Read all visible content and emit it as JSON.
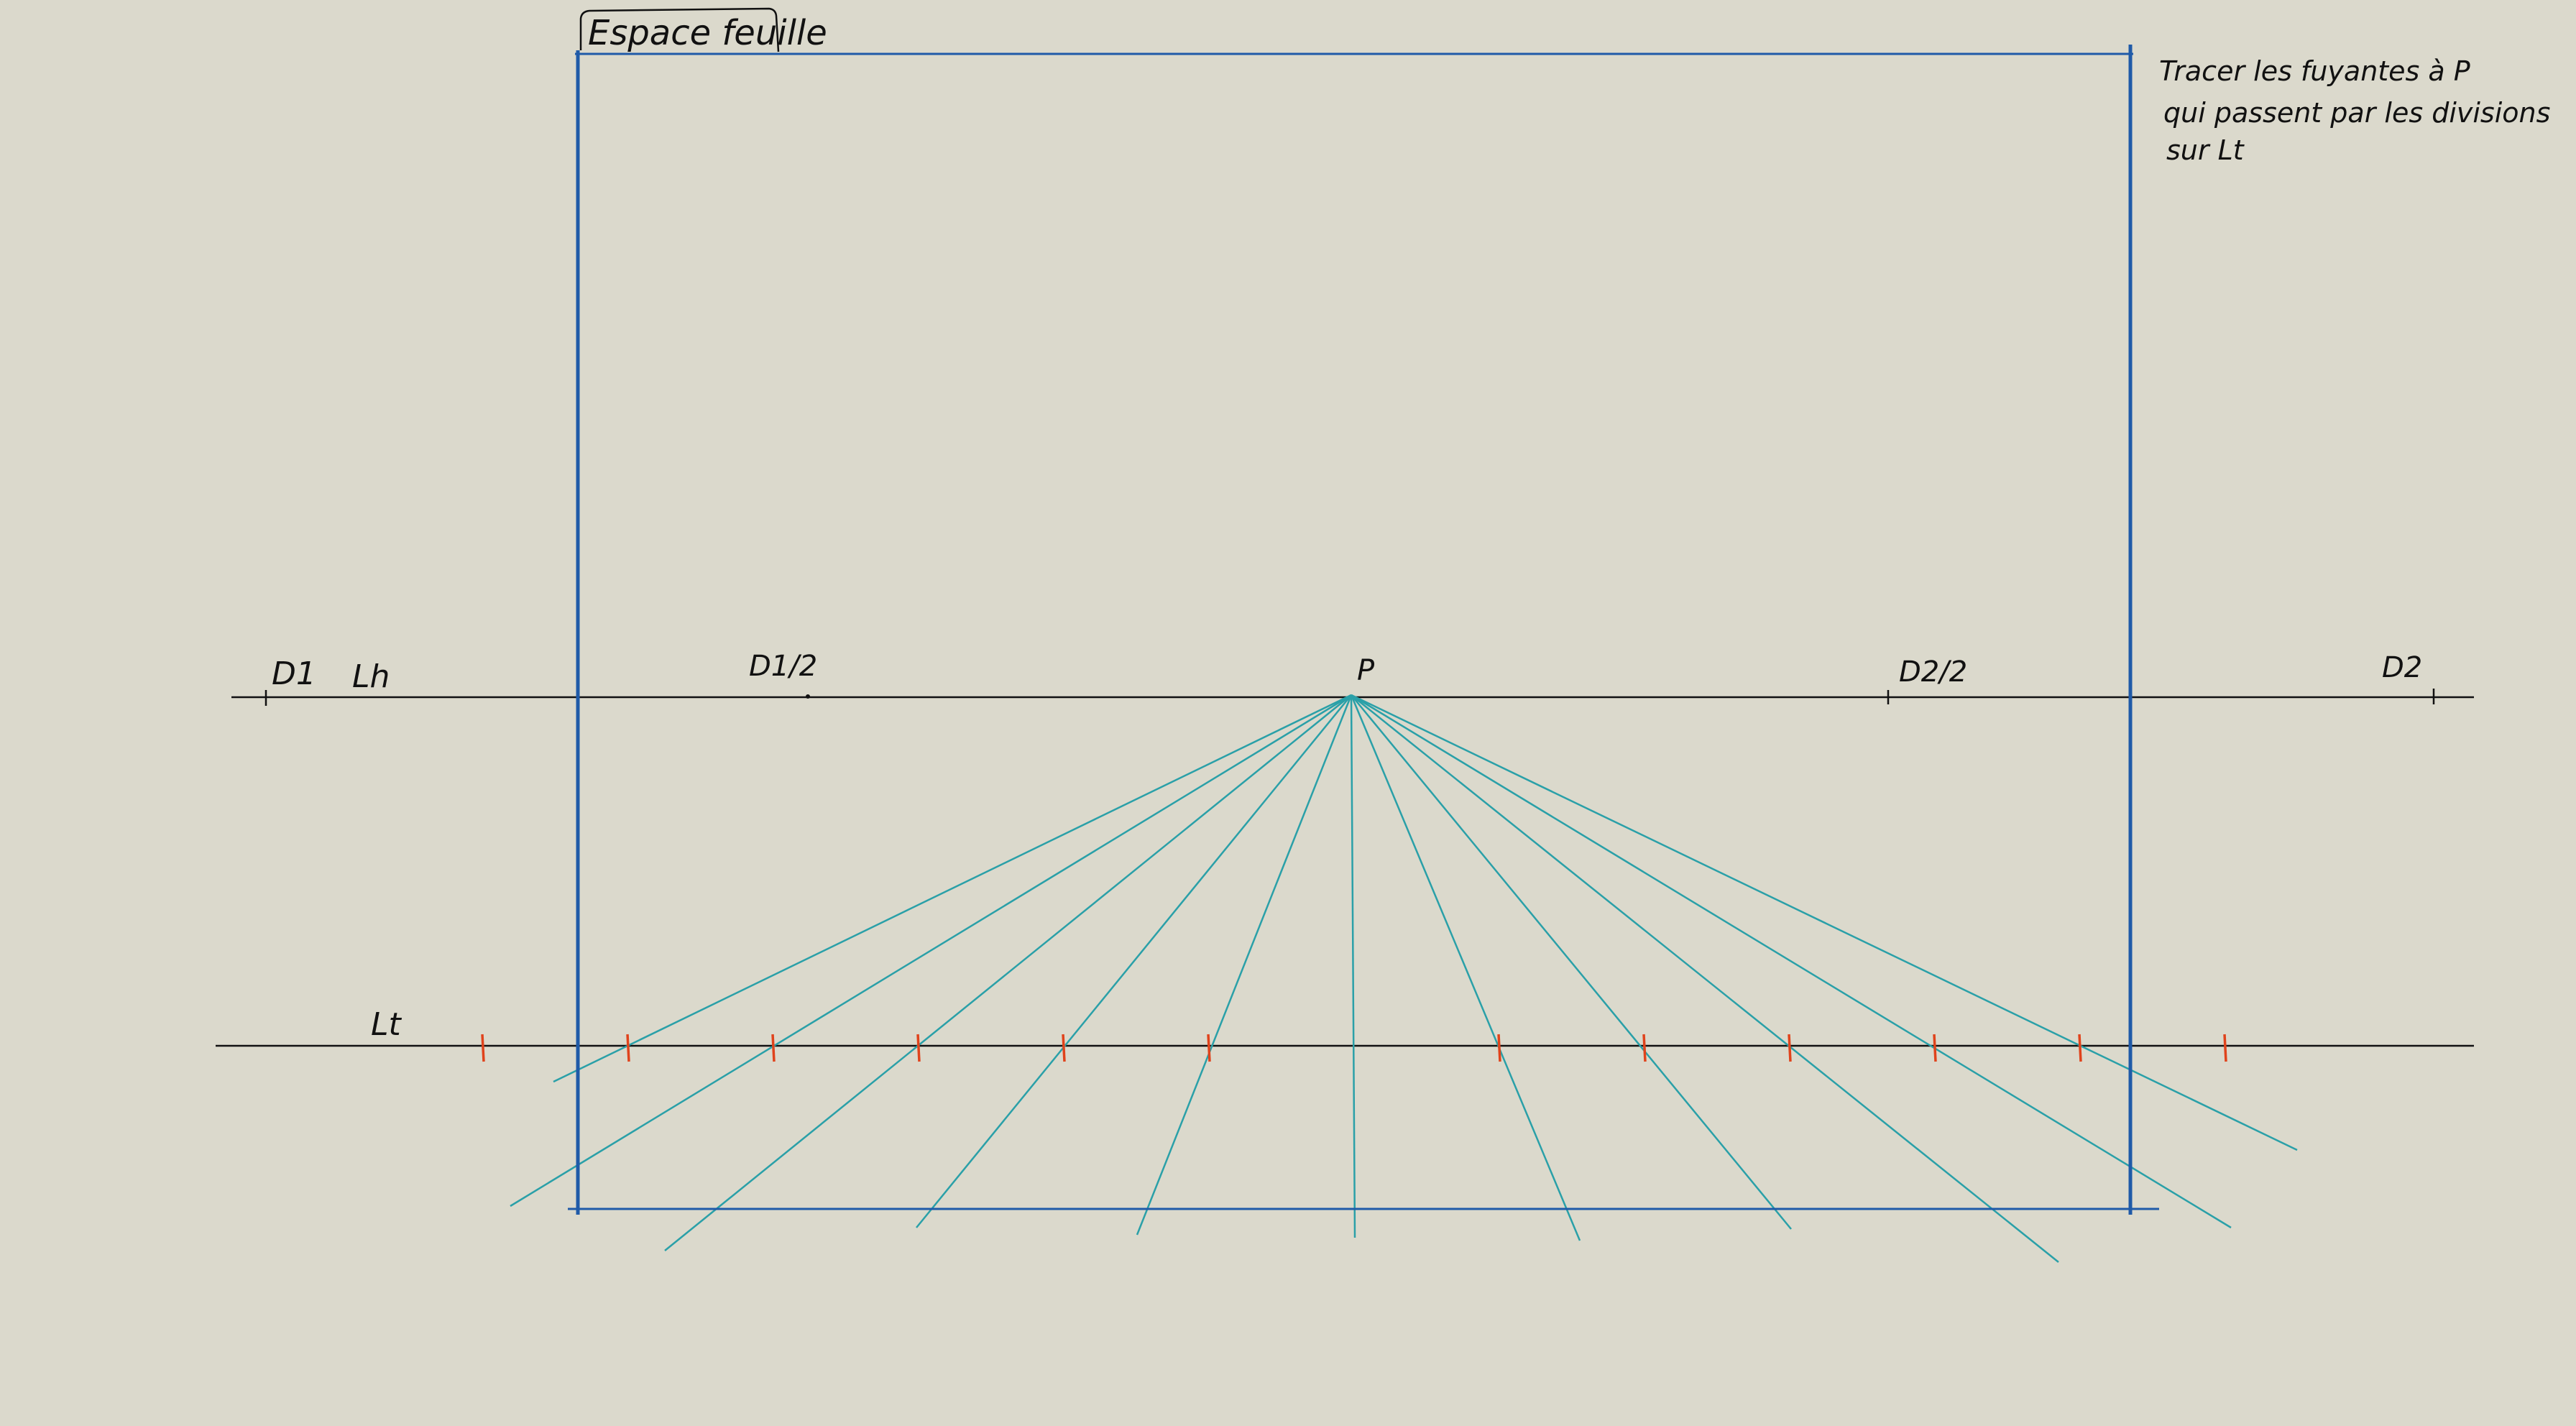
{
  "colors": {
    "background": "#dbd9cc",
    "frame": "#1f5aa8",
    "vanishing_lines": "#2aa0a8",
    "division_ticks": "#e0431c",
    "ink": "#111111"
  },
  "frame": {
    "title": "Espace feuille"
  },
  "horizon": {
    "label": "Lh",
    "points": {
      "d1": "D1",
      "d1_half": "D1/2",
      "p": "P",
      "d2_half": "D2/2",
      "d2": "D2"
    }
  },
  "ground_line": {
    "label": "Lt",
    "division_count": 13
  },
  "instruction": {
    "line1": "Tracer les fuyantes à P",
    "line2": "qui passent par les divisions",
    "line3": "sur Lt"
  }
}
